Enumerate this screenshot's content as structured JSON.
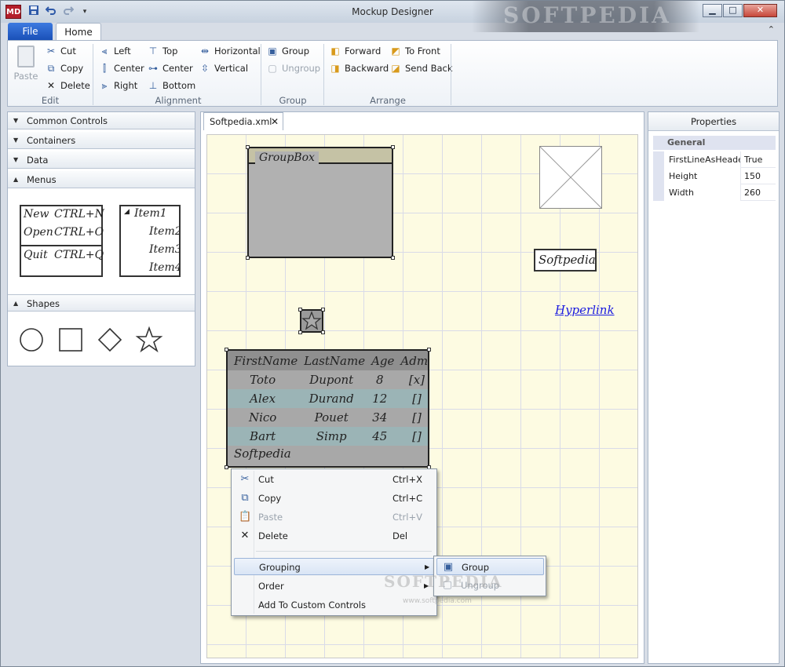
{
  "window": {
    "title": "Mockup Designer",
    "logo": "MD",
    "watermark": "SOFTPEDIA",
    "controls": {
      "minimize": "▁",
      "maximize": "□",
      "close": "✕"
    }
  },
  "quick_access": {
    "save_icon": "save-icon",
    "undo_icon": "undo-icon",
    "redo_icon": "redo-icon",
    "customize": "▾"
  },
  "ribbon": {
    "file_tab": "File",
    "home_tab": "Home",
    "collapse": "⌃",
    "groups": {
      "edit": {
        "label": "Edit",
        "paste": "Paste",
        "cut": "Cut",
        "copy": "Copy",
        "delete": "Delete"
      },
      "alignment": {
        "label": "Alignment",
        "left": "Left",
        "center1": "Center",
        "right": "Right",
        "top": "Top",
        "center2": "Center",
        "bottom": "Bottom",
        "horizontal": "Horizontal",
        "vertical": "Vertical"
      },
      "group": {
        "label": "Group",
        "group": "Group",
        "ungroup": "Ungroup"
      },
      "arrange": {
        "label": "Arrange",
        "forward": "Forward",
        "backward": "Backward",
        "to_front": "To Front",
        "send_back": "Send Back"
      }
    }
  },
  "toolbox": {
    "sections": [
      "Common Controls",
      "Containers",
      "Data",
      "Menus",
      "Shapes"
    ],
    "menus_preview": {
      "menu": [
        {
          "label": "New",
          "shortcut": "CTRL+N"
        },
        {
          "label": "Open",
          "shortcut": "CTRL+O"
        },
        {
          "label": "Quit",
          "shortcut": "CTRL+Q"
        }
      ],
      "tree": {
        "root": "Item1",
        "children": [
          "Item2",
          "Item3",
          "Item4"
        ]
      }
    },
    "shapes": [
      "circle",
      "square",
      "diamond",
      "star"
    ]
  },
  "document": {
    "tab": "Softpedia.xml",
    "close": "✕",
    "groupbox_label": "GroupBox",
    "textbox_value": "Softpedia",
    "hyperlink": "Hyperlink",
    "grid": {
      "headers": [
        "FirstName",
        "LastName",
        "Age",
        "Admin"
      ],
      "rows": [
        [
          "Toto",
          "Dupont",
          "8",
          "[x]"
        ],
        [
          "Alex",
          "Durand",
          "12",
          "[]"
        ],
        [
          "Nico",
          "Pouet",
          "34",
          "[]"
        ],
        [
          "Bart",
          "Simp",
          "45",
          "[]"
        ]
      ],
      "footer": "Softpedia"
    }
  },
  "properties": {
    "title": "Properties",
    "category": "General",
    "rows": [
      {
        "name": "FirstLineAsHeaders",
        "value": "True"
      },
      {
        "name": "Height",
        "value": "150"
      },
      {
        "name": "Width",
        "value": "260"
      }
    ]
  },
  "context_menu": {
    "items": [
      {
        "label": "Cut",
        "shortcut": "Ctrl+X"
      },
      {
        "label": "Copy",
        "shortcut": "Ctrl+C"
      },
      {
        "label": "Paste",
        "shortcut": "Ctrl+V"
      },
      {
        "label": "Delete",
        "shortcut": "Del"
      },
      {
        "label": "Grouping"
      },
      {
        "label": "Order"
      },
      {
        "label": "Add To Custom Controls"
      }
    ],
    "submenu": [
      {
        "label": "Group"
      },
      {
        "label": "Ungroup"
      }
    ],
    "watermark": "SOFTPEDIA",
    "watermark_url": "www.softpedia.com"
  }
}
